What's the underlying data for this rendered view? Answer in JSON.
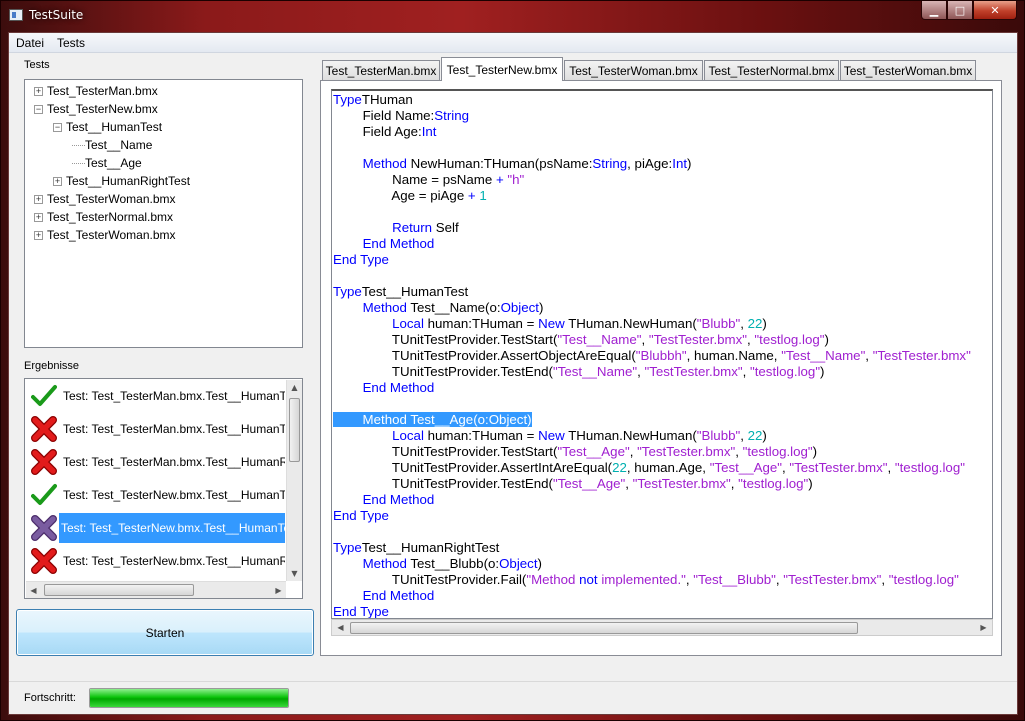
{
  "window": {
    "title": "TestSuite",
    "minimize": "▁",
    "maximize": "□",
    "close": "✕"
  },
  "menu": [
    "Datei",
    "Tests"
  ],
  "tests_group": {
    "label": "Tests",
    "tree": [
      {
        "level": 0,
        "expander": "+",
        "label": "Test_TesterMan.bmx"
      },
      {
        "level": 0,
        "expander": "−",
        "label": "Test_TesterNew.bmx"
      },
      {
        "level": 1,
        "expander": "−",
        "label": "Test__HumanTest"
      },
      {
        "level": 2,
        "expander": "",
        "label": "Test__Name"
      },
      {
        "level": 2,
        "expander": "",
        "label": "Test__Age"
      },
      {
        "level": 1,
        "expander": "+",
        "label": "Test__HumanRightTest"
      },
      {
        "level": 0,
        "expander": "+",
        "label": "Test_TesterWoman.bmx"
      },
      {
        "level": 0,
        "expander": "+",
        "label": "Test_TesterNormal.bmx"
      },
      {
        "level": 0,
        "expander": "+",
        "label": "Test_TesterWoman.bmx"
      }
    ]
  },
  "results_group": {
    "label": "Ergebnisse",
    "items": [
      {
        "status": "pass",
        "icon": "green-check-icon",
        "text": "Test: Test_TesterMan.bmx.Test__HumanTest",
        "selected": false
      },
      {
        "status": "fail",
        "icon": "red-x-icon",
        "text": "Test: Test_TesterMan.bmx.Test__HumanTest",
        "selected": false
      },
      {
        "status": "fail",
        "icon": "red-x-icon",
        "text": "Test: Test_TesterMan.bmx.Test__HumanRightTest",
        "selected": false
      },
      {
        "status": "pass",
        "icon": "green-check-icon",
        "text": "Test: Test_TesterNew.bmx.Test__HumanTest",
        "selected": false
      },
      {
        "status": "pending",
        "icon": "purple-x-icon",
        "text": "Test: Test_TesterNew.bmx.Test__HumanTest",
        "selected": true
      },
      {
        "status": "fail",
        "icon": "red-x-icon",
        "text": "Test: Test_TesterNew.bmx.Test__HumanRightTest",
        "selected": false
      }
    ]
  },
  "start_button": "Starten",
  "tabs": [
    {
      "label": "Test_TesterMan.bmx",
      "active": false
    },
    {
      "label": "Test_TesterNew.bmx",
      "active": true
    },
    {
      "label": "Test_TesterWoman.bmx",
      "active": false
    },
    {
      "label": "Test_TesterNormal.bmx",
      "active": false
    },
    {
      "label": "Test_TesterWoman.bmx",
      "active": false
    }
  ],
  "code_lines": [
    [
      [
        "kw",
        "Type"
      ],
      [
        "",
        "THuman"
      ]
    ],
    [
      [
        "",
        "\t"
      ],
      [
        "",
        "Field Name:"
      ],
      [
        "kw",
        "String"
      ]
    ],
    [
      [
        "",
        "\t"
      ],
      [
        "",
        "Field Age:"
      ],
      [
        "kw",
        "Int"
      ]
    ],
    [],
    [
      [
        "",
        "\t"
      ],
      [
        "kw",
        "Method"
      ],
      [
        "",
        ""
      ],
      [
        "",
        "NewHuman:THuman(psName:"
      ],
      [
        "kw",
        "String"
      ],
      [
        "",
        ", piAge:"
      ],
      [
        "kw",
        "Int"
      ],
      [
        "",
        ")"
      ]
    ],
    [
      [
        "",
        "\t\t"
      ],
      [
        "",
        "Name = psName "
      ],
      [
        "kw",
        "+"
      ],
      [
        "st",
        " \"h\""
      ]
    ],
    [
      [
        "",
        "\t\t"
      ],
      [
        "",
        "Age = piAge "
      ],
      [
        "kw",
        "+"
      ],
      [
        "nm",
        " 1"
      ]
    ],
    [],
    [
      [
        "",
        "\t\t"
      ],
      [
        "kw",
        "Return"
      ],
      [
        "",
        ""
      ],
      [
        "",
        "Self"
      ]
    ],
    [
      [
        "",
        "\t"
      ],
      [
        "kw",
        "End Method"
      ]
    ],
    [
      [
        "kw",
        "End Type"
      ]
    ],
    [],
    [
      [
        "kw",
        "Type"
      ],
      [
        "",
        "Test__HumanTest"
      ]
    ],
    [
      [
        "",
        "\t"
      ],
      [
        "kw",
        "Method"
      ],
      [
        "",
        ""
      ],
      [
        "",
        "Test__Name(o:"
      ],
      [
        "kw",
        "Object"
      ],
      [
        "",
        ")"
      ]
    ],
    [
      [
        "",
        "\t\t"
      ],
      [
        "kw",
        "Local"
      ],
      [
        "",
        ""
      ],
      [
        "",
        "human:THuman = "
      ],
      [
        "kw",
        "New"
      ],
      [
        "",
        ""
      ],
      [
        "",
        "THuman.NewHuman("
      ],
      [
        "st",
        "\"Blubb\""
      ],
      [
        "",
        ", "
      ],
      [
        "nm",
        "22"
      ],
      [
        "",
        ")"
      ]
    ],
    [
      [
        "",
        "\t\t"
      ],
      [
        "",
        "TUnitTestProvider.TestStart("
      ],
      [
        "st",
        "\"Test__Name\""
      ],
      [
        "",
        ", "
      ],
      [
        "st",
        "\"TestTester.bmx\""
      ],
      [
        "",
        ", "
      ],
      [
        "st",
        "\"testlog.log\""
      ],
      [
        "",
        ")"
      ]
    ],
    [
      [
        "",
        "\t\t"
      ],
      [
        "",
        "TUnitTestProvider.AssertObjectAreEqual("
      ],
      [
        "st",
        "\"Blubbh\""
      ],
      [
        "",
        ", human.Name, "
      ],
      [
        "st",
        "\"Test__Name\""
      ],
      [
        "",
        ", "
      ],
      [
        "st",
        "\"TestTester.bmx\""
      ]
    ],
    [
      [
        "",
        "\t\t"
      ],
      [
        "",
        "TUnitTestProvider.TestEnd("
      ],
      [
        "st",
        "\"Test__Name\""
      ],
      [
        "",
        ", "
      ],
      [
        "st",
        "\"TestTester.bmx\""
      ],
      [
        "",
        ", "
      ],
      [
        "st",
        "\"testlog.log\""
      ],
      [
        "",
        ")"
      ]
    ],
    [
      [
        "",
        "\t"
      ],
      [
        "kw",
        "End Method"
      ]
    ],
    [],
    [
      [
        "hl",
        "\tMethod Test__Age(o:Object)"
      ]
    ],
    [
      [
        "",
        "\t\t"
      ],
      [
        "kw",
        "Local"
      ],
      [
        "",
        ""
      ],
      [
        "",
        "human:THuman = "
      ],
      [
        "kw",
        "New"
      ],
      [
        "",
        ""
      ],
      [
        "",
        "THuman.NewHuman("
      ],
      [
        "st",
        "\"Blubb\""
      ],
      [
        "",
        ", "
      ],
      [
        "nm",
        "22"
      ],
      [
        "",
        ")"
      ]
    ],
    [
      [
        "",
        "\t\t"
      ],
      [
        "",
        "TUnitTestProvider.TestStart("
      ],
      [
        "st",
        "\"Test__Age\""
      ],
      [
        "",
        ", "
      ],
      [
        "st",
        "\"TestTester.bmx\""
      ],
      [
        "",
        ", "
      ],
      [
        "st",
        "\"testlog.log\""
      ],
      [
        "",
        ")"
      ]
    ],
    [
      [
        "",
        "\t\t"
      ],
      [
        "",
        "TUnitTestProvider.AssertIntAreEqual("
      ],
      [
        "nm",
        "22"
      ],
      [
        "",
        ", human.Age, "
      ],
      [
        "st",
        "\"Test__Age\""
      ],
      [
        "",
        ", "
      ],
      [
        "st",
        "\"TestTester.bmx\""
      ],
      [
        "",
        ", "
      ],
      [
        "st",
        "\"testlog.log\""
      ]
    ],
    [
      [
        "",
        "\t\t"
      ],
      [
        "",
        "TUnitTestProvider.TestEnd("
      ],
      [
        "st",
        "\"Test__Age\""
      ],
      [
        "",
        ", "
      ],
      [
        "st",
        "\"TestTester.bmx\""
      ],
      [
        "",
        ", "
      ],
      [
        "st",
        "\"testlog.log\""
      ],
      [
        "",
        ")"
      ]
    ],
    [
      [
        "",
        "\t"
      ],
      [
        "kw",
        "End Method"
      ]
    ],
    [
      [
        "kw",
        "End Type"
      ]
    ],
    [],
    [
      [
        "kw",
        "Type"
      ],
      [
        "",
        "Test__HumanRightTest"
      ]
    ],
    [
      [
        "",
        "\t"
      ],
      [
        "kw",
        "Method"
      ],
      [
        "",
        ""
      ],
      [
        "",
        "Test__Blubb(o:"
      ],
      [
        "kw",
        "Object"
      ],
      [
        "",
        ")"
      ]
    ],
    [
      [
        "",
        "\t\t"
      ],
      [
        "",
        "TUnitTestProvider.Fail("
      ],
      [
        "st",
        "\"Method "
      ],
      [
        "kw",
        "not"
      ],
      [
        "st",
        " implemented.\""
      ],
      [
        "",
        ", "
      ],
      [
        "st",
        "\"Test__Blubb\""
      ],
      [
        "",
        ", "
      ],
      [
        "st",
        "\"TestTester.bmx\""
      ],
      [
        "",
        ", "
      ],
      [
        "st",
        "\"testlog.log\""
      ]
    ],
    [
      [
        "",
        "\t"
      ],
      [
        "kw",
        "End Method"
      ]
    ],
    [
      [
        "kw",
        "End Type"
      ]
    ]
  ],
  "status": {
    "label": "Fortschritt:",
    "progress": 1.0
  },
  "colors": {
    "keyword": "#0000ff",
    "string": "#a020d0",
    "number": "#00b0b0",
    "selection": "#3399ff",
    "progress": "#00c000"
  }
}
